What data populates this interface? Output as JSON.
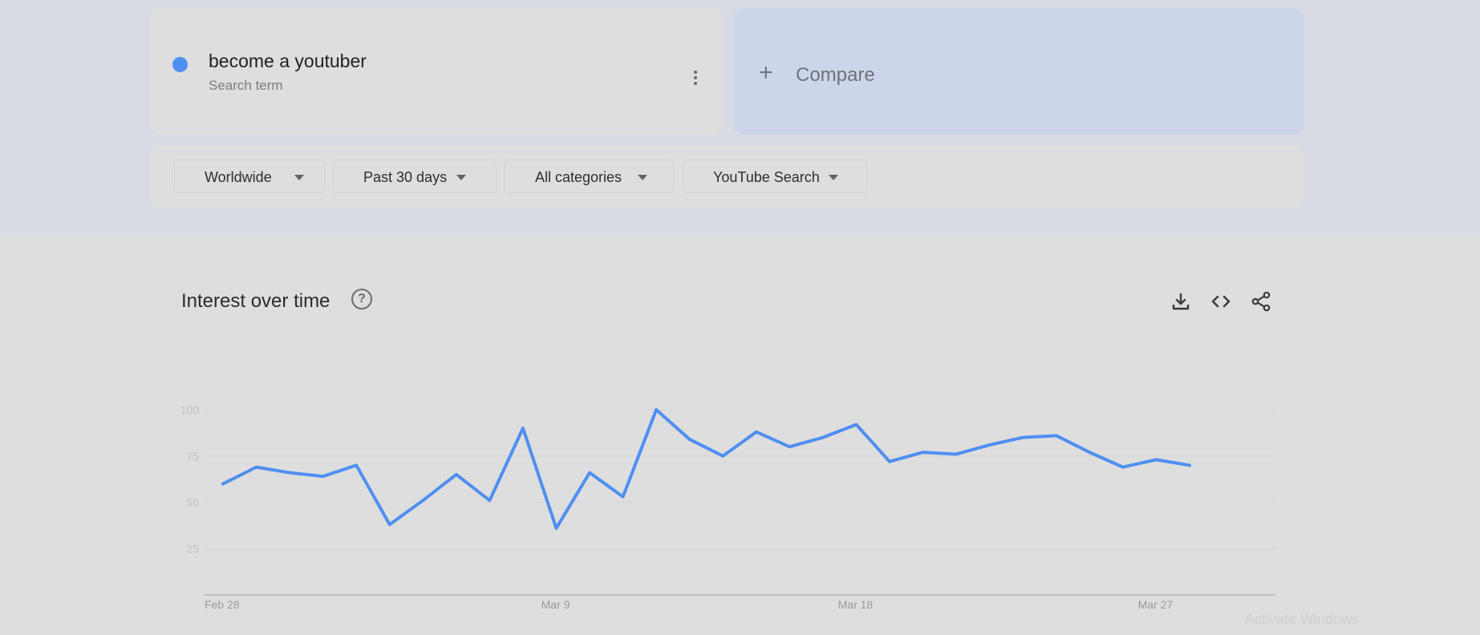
{
  "search_term": {
    "title": "become a youtuber",
    "subtitle": "Search term",
    "dot_color": "#4f8ff2",
    "menu_icon": "more-vert-icon"
  },
  "compare": {
    "icon": "plus-icon",
    "label": "Compare"
  },
  "filters": [
    {
      "label": "Worldwide"
    },
    {
      "label": "Past 30 days"
    },
    {
      "label": "All categories"
    },
    {
      "label": "YouTube Search"
    }
  ],
  "chart_card": {
    "title": "Interest over time",
    "help_icon": "help-circle-icon",
    "actions": [
      "download-icon",
      "embed-code-icon",
      "share-icon"
    ]
  },
  "chart_data": {
    "type": "line",
    "title": "",
    "xlabel": "",
    "ylabel": "",
    "x_ticks": [
      "Feb 28",
      "Mar 9",
      "Mar 18",
      "Mar 27"
    ],
    "y_ticks": [
      25,
      50,
      75,
      100
    ],
    "ylim": [
      0,
      100
    ],
    "grid": true,
    "x": [
      "Feb 28",
      "Feb 29",
      "Mar 1",
      "Mar 2",
      "Mar 3",
      "Mar 4",
      "Mar 5",
      "Mar 6",
      "Mar 7",
      "Mar 8",
      "Mar 9",
      "Mar 10",
      "Mar 11",
      "Mar 12",
      "Mar 13",
      "Mar 14",
      "Mar 15",
      "Mar 16",
      "Mar 17",
      "Mar 18",
      "Mar 19",
      "Mar 20",
      "Mar 21",
      "Mar 22",
      "Mar 23",
      "Mar 24",
      "Mar 25",
      "Mar 26",
      "Mar 27",
      "Mar 28",
      "Mar 29",
      "Mar 30"
    ],
    "series": [
      {
        "color": "#4f8ff2",
        "values": [
          60,
          69,
          66,
          64,
          70,
          38,
          51,
          65,
          51,
          90,
          36,
          66,
          53,
          100,
          84,
          75,
          88,
          80,
          85,
          92,
          72,
          77,
          76,
          81,
          85,
          86,
          77,
          69,
          73,
          70
        ]
      }
    ]
  },
  "watermark": "Activate Windows"
}
